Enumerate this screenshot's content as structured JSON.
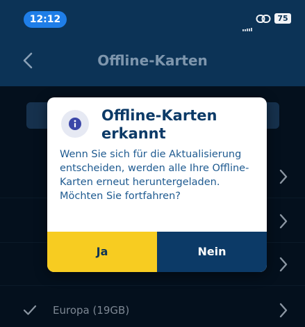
{
  "status_bar": {
    "time": "12:12",
    "battery": "75"
  },
  "nav": {
    "title": "Offline-Karten"
  },
  "list": {
    "rows": [
      {
        "label": ""
      },
      {
        "label": ""
      },
      {
        "label": ""
      },
      {
        "label": "Europa (19GB)",
        "checked": true
      }
    ]
  },
  "dialog": {
    "icon": "info-icon",
    "title_line1": "Offline-Karten",
    "title_line2": "erkannt",
    "message": "Wenn Sie sich für die Aktualisierung entscheiden, werden alle Ihre Offline-Karten erneut heruntergeladen. Möchten Sie fortfahren?",
    "yes_label": "Ja",
    "no_label": "Nein"
  },
  "colors": {
    "header": "#0c3356",
    "accent_yellow": "#f7cc21",
    "accent_navy": "#0c3a67",
    "time_pill": "#1f7ee8"
  }
}
